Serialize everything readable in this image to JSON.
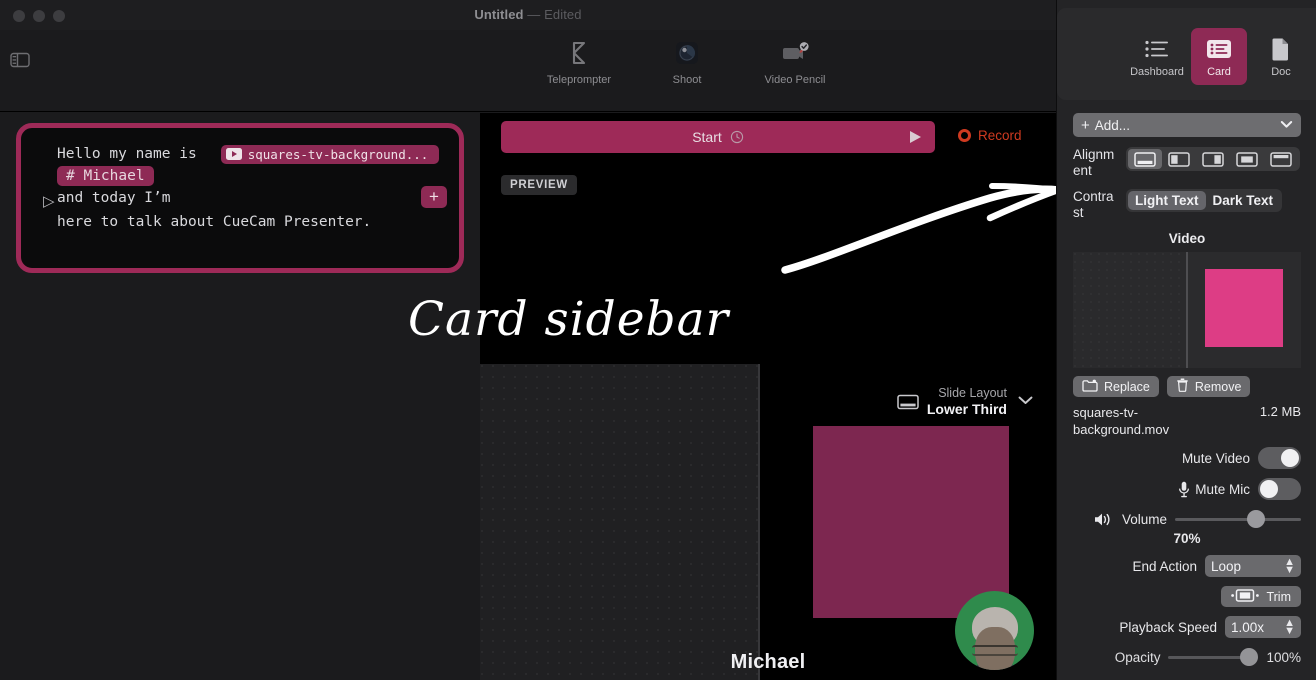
{
  "window": {
    "title": "Untitled",
    "dash": "—",
    "edited": "Edited"
  },
  "toolbar": {
    "items": [
      {
        "label": "Teleprompter",
        "icon": "teleprompter-icon"
      },
      {
        "label": "Shoot",
        "icon": "shoot-camera-icon"
      },
      {
        "label": "Video Pencil",
        "icon": "video-pencil-icon"
      }
    ],
    "sidebar_toggle_icon": "sidebar-toggle-icon"
  },
  "teleprompter": {
    "line1": "Hello my name is",
    "video_chip": "squares-tv-background....",
    "name_chip": "# Michael",
    "line3": "and today I’m",
    "line4": "here to talk about CueCam Presenter.",
    "add_label": "+",
    "disclosure_icon": "disclosure-triangle-icon"
  },
  "stage": {
    "start_label": "Start",
    "record_label": "Record",
    "preview_label": "PREVIEW",
    "clock_icon": "clock-icon",
    "play_icon": "play-triangle-icon",
    "record_icon": "record-dot-icon"
  },
  "annotation": {
    "text": "Card sidebar",
    "arrow_icon": "curved-arrow-icon"
  },
  "preview": {
    "slide_layout_label": "Slide Layout",
    "slide_layout_value": "Lower Third",
    "slide_layout_icon": "slide-layout-icon",
    "chevron_icon": "chevron-down-icon",
    "presenter_name": "Michael",
    "avatar_icon": "presenter-avatar"
  },
  "sidebar": {
    "tabs": [
      {
        "label": "Dashboard",
        "icon": "dashboard-list-icon",
        "active": false
      },
      {
        "label": "Card",
        "icon": "card-icon",
        "active": true
      },
      {
        "label": "Doc",
        "icon": "doc-page-icon",
        "active": false
      }
    ],
    "add": {
      "label": "Add...",
      "plus": "+",
      "chevron_icon": "chevron-down-icon"
    },
    "alignment": {
      "label": "Alignment",
      "options": [
        "align-bottom-bar-icon",
        "align-left-split-icon",
        "align-right-split-icon",
        "align-center-box-icon",
        "align-top-bar-icon"
      ],
      "selected_index": 0
    },
    "contrast": {
      "label": "Contrast",
      "options": [
        "Light Text",
        "Dark Text"
      ],
      "selected": "Light Text"
    },
    "video": {
      "section_title": "Video",
      "replace_label": "Replace",
      "replace_icon": "folder-replace-icon",
      "remove_label": "Remove",
      "remove_icon": "trash-icon",
      "file_name": "squares-tv-background.mov",
      "file_size": "1.2 MB",
      "mute_video_label": "Mute Video",
      "mute_video_on": true,
      "mute_mic_label": "Mute Mic",
      "mute_mic_icon": "microphone-icon",
      "mute_mic_on": false,
      "volume_label": "Volume",
      "volume_icon": "speaker-icon",
      "volume_value": "70%",
      "end_action_label": "End Action",
      "end_action_value": "Loop",
      "trim_label": "Trim",
      "trim_icon": "trim-icon",
      "playback_speed_label": "Playback Speed",
      "playback_speed_value": "1.00x",
      "opacity_label": "Opacity",
      "opacity_value": "100%"
    },
    "colors": {
      "accent_pink": "#8e2a55",
      "thumb_pink": "#dd3d85",
      "record_red": "#cf3a20"
    }
  }
}
